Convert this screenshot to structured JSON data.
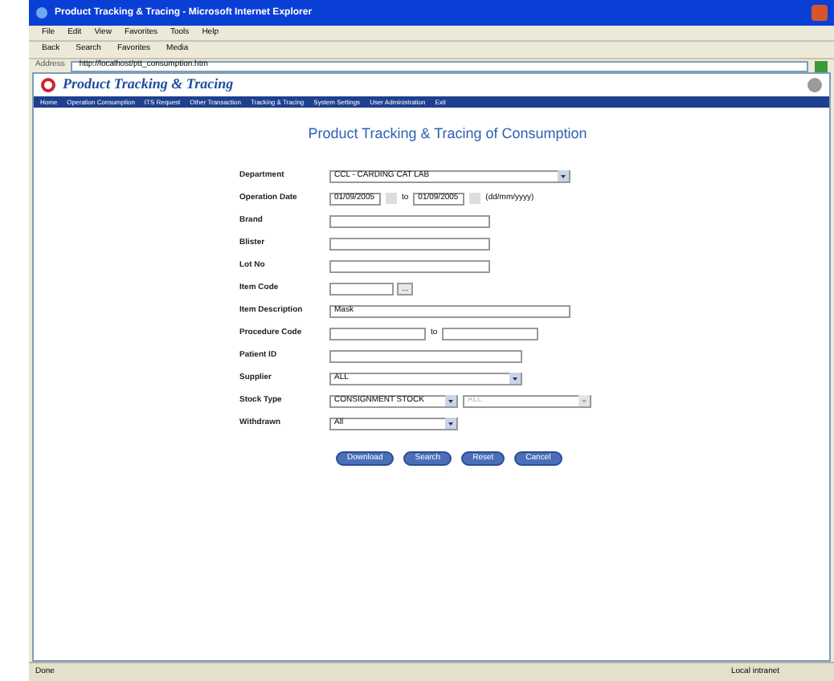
{
  "window": {
    "title": "Product Tracking & Tracing - Microsoft Internet Explorer"
  },
  "menu": [
    "File",
    "Edit",
    "View",
    "Favorites",
    "Tools",
    "Help"
  ],
  "toolbar": [
    "Back",
    "Search",
    "Favorites",
    "Media"
  ],
  "address": {
    "label": "Address",
    "value": "http://localhost/ptt_consumption.htm"
  },
  "header": {
    "title": "Product Tracking & Tracing"
  },
  "nav": [
    "Home",
    "Operation Consumption",
    "ITS Request",
    "Other Transaction",
    "Tracking & Tracing",
    "System Settings",
    "User Administration",
    "Exit"
  ],
  "form": {
    "heading": "Product Tracking & Tracing of Consumption",
    "fields": [
      {
        "kind": "select",
        "label": "Department",
        "value": "CCL - CARDING CAT LAB"
      },
      {
        "kind": "date_range",
        "label": "Operation Date",
        "from": "01/09/2005",
        "to_label": "to",
        "to": "01/09/2005",
        "hint": "(dd/mm/yyyy)"
      },
      {
        "kind": "text",
        "label": "Brand"
      },
      {
        "kind": "text",
        "label": "Blister"
      },
      {
        "kind": "text",
        "label": "Lot No"
      },
      {
        "kind": "lookup",
        "label": "Item Code",
        "button": "..."
      },
      {
        "kind": "text",
        "label": "Item Description",
        "value": "Mask"
      },
      {
        "kind": "range",
        "label": "Procedure Code",
        "to_label": "to"
      },
      {
        "kind": "text",
        "label": "Patient ID"
      },
      {
        "kind": "select",
        "label": "Supplier",
        "value": "ALL"
      },
      {
        "kind": "select_pair",
        "label": "Stock Type",
        "value": "CONSIGNMENT STOCK",
        "second": "ALL",
        "second_disabled": true
      },
      {
        "kind": "select",
        "label": "Withdrawn",
        "value": "All"
      }
    ],
    "buttons": [
      "Download",
      "Search",
      "Reset",
      "Cancel"
    ]
  },
  "status_bar": {
    "left": "Done",
    "right": "Local intranet"
  }
}
